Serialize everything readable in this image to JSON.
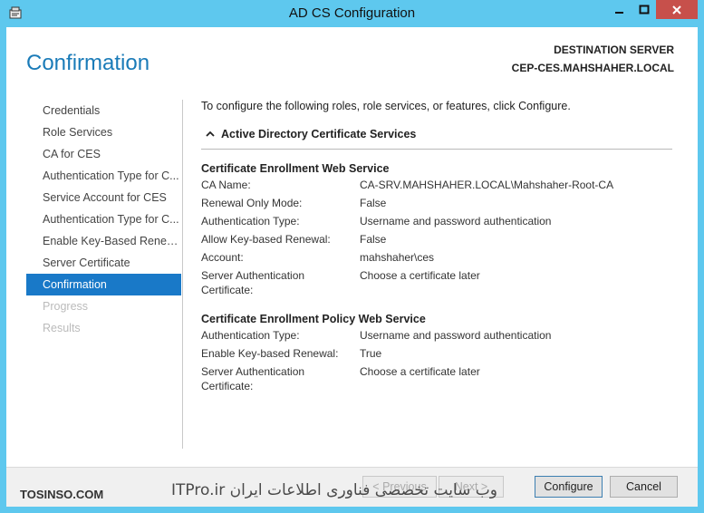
{
  "window": {
    "title": "AD CS Configuration",
    "colors": {
      "frame": "#5ec8ee",
      "accent": "#1a7bb8",
      "selection": "#1979c8",
      "close": "#c7504b"
    }
  },
  "header": {
    "page_title": "Confirmation",
    "destination_label": "DESTINATION SERVER",
    "destination_server": "CEP-CES.MAHSHAHER.LOCAL"
  },
  "nav": {
    "items": [
      {
        "label": "Credentials",
        "state": "normal"
      },
      {
        "label": "Role Services",
        "state": "normal"
      },
      {
        "label": "CA for CES",
        "state": "normal"
      },
      {
        "label": "Authentication Type for C...",
        "state": "normal"
      },
      {
        "label": "Service Account for CES",
        "state": "normal"
      },
      {
        "label": "Authentication Type for C...",
        "state": "normal"
      },
      {
        "label": "Enable Key-Based Renew...",
        "state": "normal"
      },
      {
        "label": "Server Certificate",
        "state": "normal"
      },
      {
        "label": "Confirmation",
        "state": "active"
      },
      {
        "label": "Progress",
        "state": "disabled"
      },
      {
        "label": "Results",
        "state": "disabled"
      }
    ]
  },
  "content": {
    "intro": "To configure the following roles, role services, or features, click Configure.",
    "section_title": "Active Directory Certificate Services",
    "ces": {
      "title": "Certificate Enrollment Web Service",
      "rows": [
        {
          "key": "CA Name:",
          "value": "CA-SRV.MAHSHAHER.LOCAL\\Mahshaher-Root-CA"
        },
        {
          "key": "Renewal Only Mode:",
          "value": "False"
        },
        {
          "key": "Authentication Type:",
          "value": "Username and password authentication"
        },
        {
          "key": "Allow Key-based Renewal:",
          "value": "False"
        },
        {
          "key": "Account:",
          "value": "mahshaher\\ces"
        },
        {
          "key": "Server Authentication Certificate:",
          "value": "Choose a certificate later"
        }
      ]
    },
    "cep": {
      "title": "Certificate Enrollment Policy Web Service",
      "rows": [
        {
          "key": "Authentication Type:",
          "value": "Username and password authentication"
        },
        {
          "key": "Enable Key-based Renewal:",
          "value": "True"
        },
        {
          "key": "Server Authentication Certificate:",
          "value": "Choose a certificate later"
        }
      ]
    }
  },
  "footer": {
    "previous_label": "< Previous",
    "next_label": "Next >",
    "configure_label": "Configure",
    "cancel_label": "Cancel",
    "watermark_left": "TOSINSO.COM",
    "watermark_right": "ITPro.ir وب سایت تخصصی فناوری اطلاعات ایران"
  }
}
